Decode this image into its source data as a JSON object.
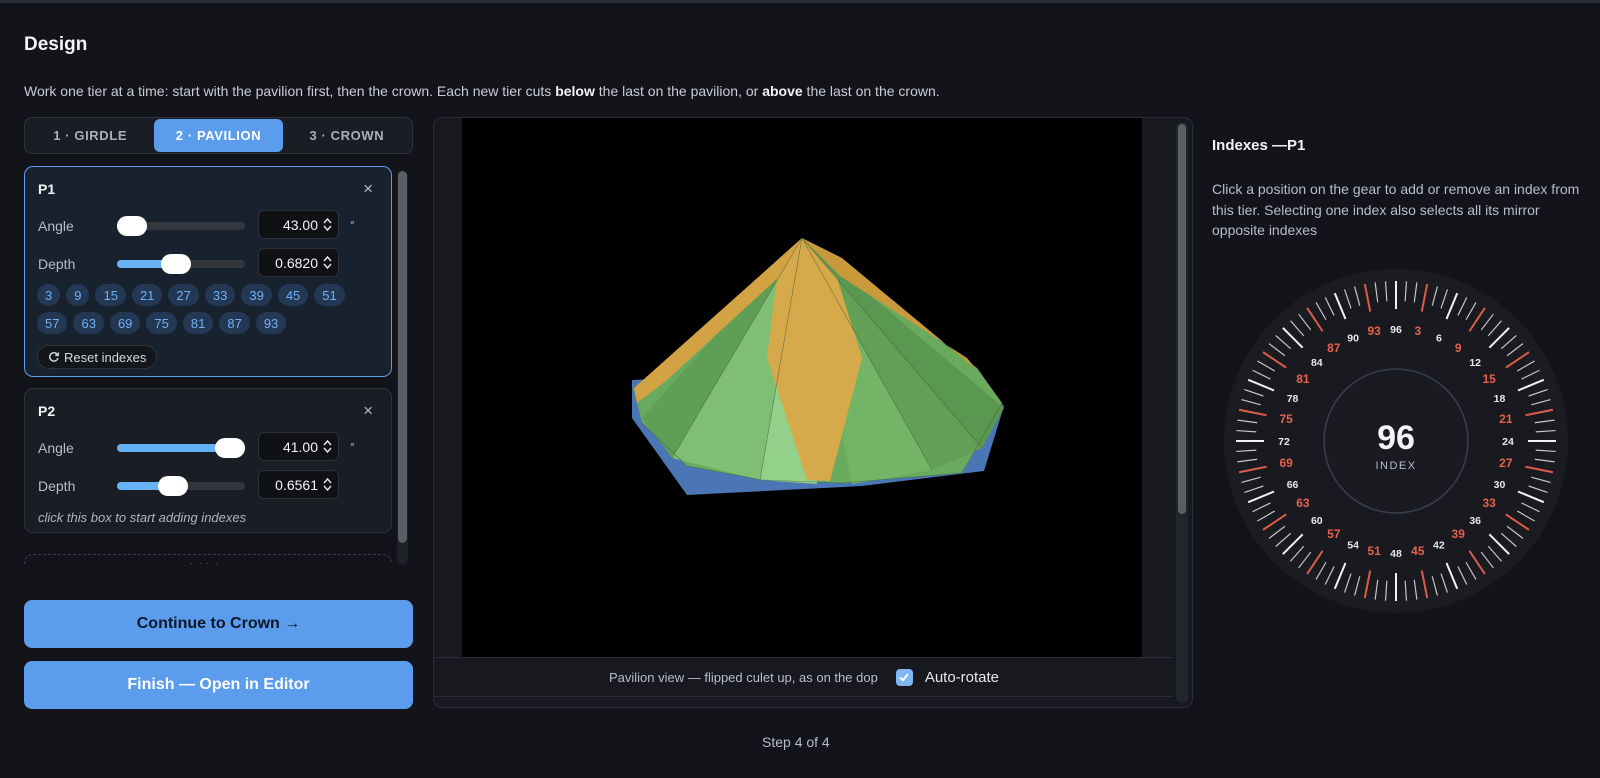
{
  "page": {
    "title": "Design",
    "intro_parts": [
      "Work one tier at a time: start with the pavilion first, then the crown. Each new tier cuts ",
      "below",
      " the last on the pavilion, or ",
      "above",
      " the last on the crown."
    ],
    "step_label": "Step 4 of 4"
  },
  "tabs": [
    {
      "label": "1 · GIRDLE",
      "active": false
    },
    {
      "label": "2 · PAVILION",
      "active": true
    },
    {
      "label": "3 · CROWN",
      "active": false
    }
  ],
  "tiers": [
    {
      "name": "P1",
      "active": true,
      "close_symbol": "×",
      "angle_label": "Angle",
      "angle_value": "43.00",
      "angle_unit": "°",
      "angle_fraction": 0.12,
      "depth_label": "Depth",
      "depth_value": "0.6820",
      "depth_fraction": 0.46,
      "indexes": [
        "3",
        "9",
        "15",
        "21",
        "27",
        "33",
        "39",
        "45",
        "51",
        "57",
        "63",
        "69",
        "75",
        "81",
        "87",
        "93"
      ],
      "reset_label": "Reset indexes"
    },
    {
      "name": "P2",
      "active": false,
      "close_symbol": "×",
      "angle_label": "Angle",
      "angle_value": "41.00",
      "angle_unit": "°",
      "angle_fraction": 0.88,
      "depth_label": "Depth",
      "depth_value": "0.6561",
      "depth_fraction": 0.44,
      "hint": "click this box to start adding indexes"
    }
  ],
  "add_tier_label": "Add tier",
  "buttons": {
    "continue_label": "Continue to Crown →",
    "finish_label": "Finish — Open in Editor"
  },
  "viewer": {
    "caption": "Pavilion view — flipped culet up, as on the dop",
    "autorotate_label": "Auto-rotate",
    "autorotate_checked": true
  },
  "index_panel": {
    "title": "Indexes —P1",
    "description": "Click a position on the gear to add or remove an index from this tier. Selecting one index also selects all its mirror opposite indexes",
    "center_value": "96",
    "center_label": "INDEX",
    "gear_teeth": 96,
    "labeled_indexes": [
      3,
      6,
      9,
      12,
      15,
      18,
      21,
      24,
      27,
      30,
      33,
      36,
      39,
      42,
      45,
      48,
      51,
      54,
      57,
      60,
      63,
      66,
      69,
      72,
      75,
      78,
      81,
      84,
      87,
      90,
      93,
      96
    ],
    "selected_indexes": [
      3,
      9,
      15,
      21,
      27,
      33,
      39,
      45,
      51,
      57,
      63,
      69,
      75,
      81,
      87,
      93
    ],
    "colors": {
      "selected": "#e8604c",
      "normal": "#ffffff"
    }
  }
}
